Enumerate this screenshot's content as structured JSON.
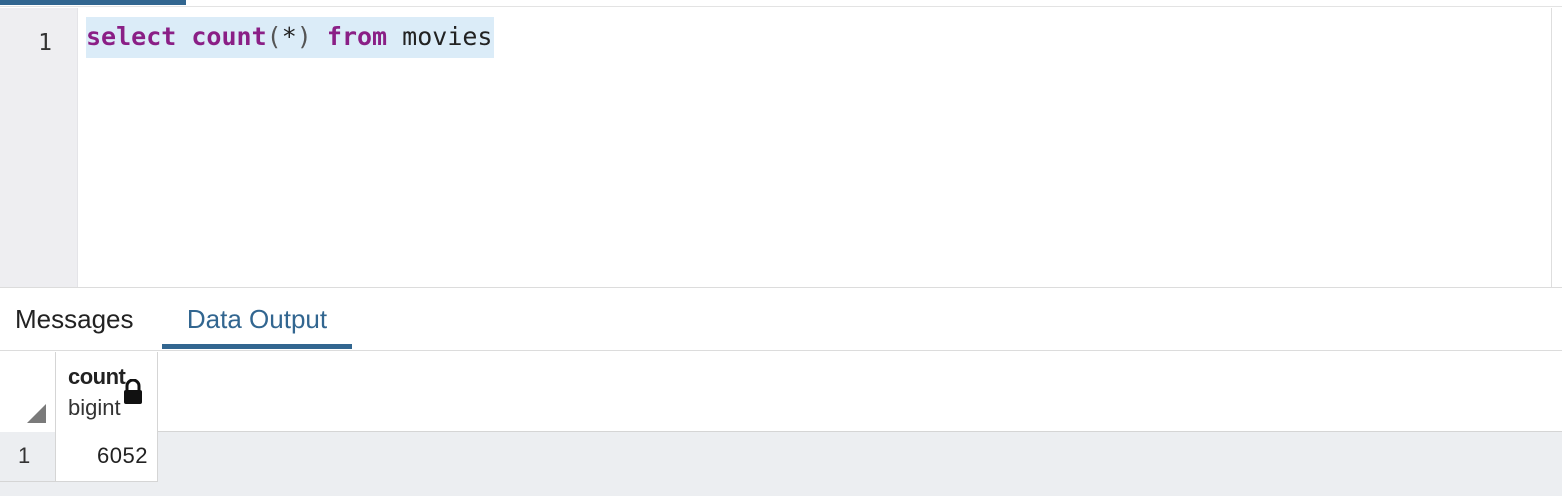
{
  "editor": {
    "line_number": "1",
    "code": {
      "kw_select": "select",
      "kw_count": "count",
      "paren_open": "(",
      "star": "*",
      "paren_close": ")",
      "kw_from": "from",
      "table": "movies"
    },
    "colors": {
      "keyword": "#8a1f86",
      "selection": "#dbecf8",
      "accent": "#326690"
    }
  },
  "results_tabs": {
    "messages_label": "Messages",
    "data_output_label": "Data Output",
    "active": "Data Output"
  },
  "grid": {
    "columns": [
      {
        "name": "count",
        "type": "bigint",
        "icon": "lock-icon"
      }
    ],
    "rows": [
      {
        "row_number": "1",
        "values": [
          "6052"
        ]
      }
    ]
  }
}
